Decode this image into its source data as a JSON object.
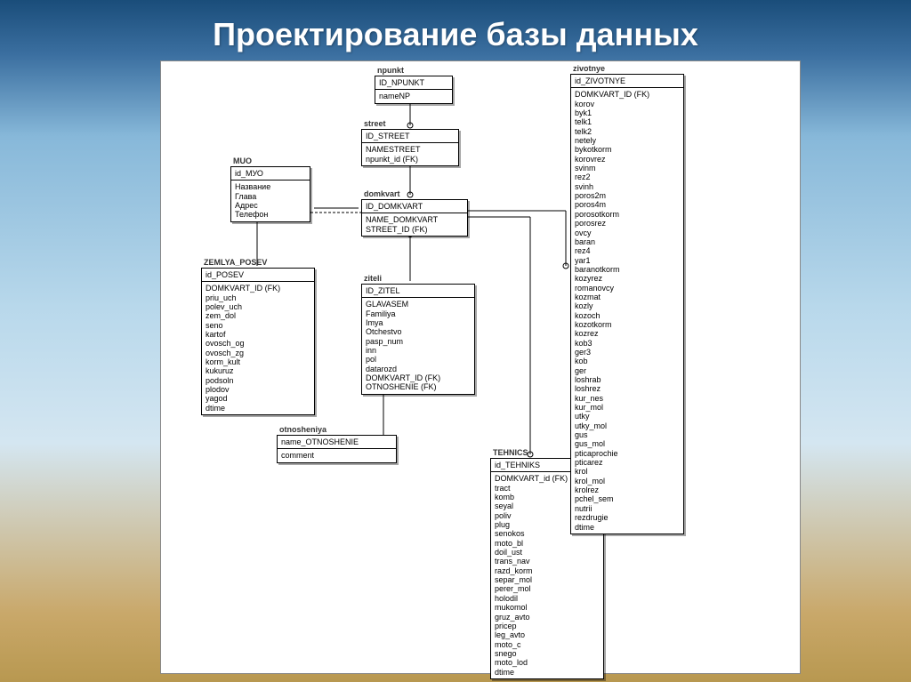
{
  "title": "Проектирование базы данных",
  "entities": {
    "npunkt": {
      "name": "npunkt",
      "pk": [
        "ID_NPUNKT"
      ],
      "fields": [
        "nameNP"
      ]
    },
    "street": {
      "name": "street",
      "pk": [
        "ID_STREET"
      ],
      "fields": [
        "NAMESTREET",
        "npunkt_id (FK)"
      ]
    },
    "muo": {
      "name": "MUO",
      "pk": [
        "id_МУО"
      ],
      "fields": [
        "Название",
        "Глава",
        "Адрес",
        "Телефон"
      ]
    },
    "domkvart": {
      "name": "domkvart",
      "pk": [
        "ID_DOMKVART"
      ],
      "fields": [
        "NAME_DOMKVART",
        "STREET_ID (FK)"
      ]
    },
    "zemlya": {
      "name": "ZEMLYA_POSEV",
      "pk": [
        "id_POSEV"
      ],
      "fields": [
        "DOMKVART_ID (FK)",
        "priu_uch",
        "polev_uch",
        "zem_dol",
        "seno",
        "kartof",
        "ovosch_og",
        "ovosch_zg",
        "korm_kult",
        "kukuruz",
        "podsoln",
        "plodov",
        "yagod",
        "dtime"
      ]
    },
    "ziteli": {
      "name": "ziteli",
      "pk": [
        "ID_ZITEL"
      ],
      "fields": [
        "GLAVASEM",
        "Familiya",
        "Imya",
        "Otchestvo",
        "pasp_num",
        "inn",
        "pol",
        "datarozd",
        "DOMKVART_ID (FK)",
        "OTNOSHENIE (FK)"
      ]
    },
    "otnosheniya": {
      "name": "otnosheniya",
      "pk": [
        "name_OTNOSHENIE"
      ],
      "fields": [
        "comment"
      ]
    },
    "zivotnye": {
      "name": "zivotnye",
      "pk": [
        "id_ZIVOTNYE"
      ],
      "fields": [
        "DOMKVART_ID (FK)",
        "korov",
        "byk1",
        "telk1",
        "telk2",
        "netely",
        "bykotkorm",
        "korovrez",
        "svinm",
        "rez2",
        "svinh",
        "poros2m",
        "poros4m",
        "porosotkorm",
        "porosrez",
        "ovcy",
        "baran",
        "rez4",
        "yar1",
        "baranotkorm",
        "kozyrez",
        "romanovcy",
        "kozmat",
        "kozly",
        "kozoch",
        "kozotkorm",
        "kozrez",
        "kob3",
        "ger3",
        "kob",
        "ger",
        "loshrab",
        "loshrez",
        "kur_nes",
        "kur_mol",
        "utky",
        "utky_mol",
        "gus",
        "gus_mol",
        "pticaprochie",
        "pticarez",
        "krol",
        "krol_mol",
        "krolrez",
        "pchel_sem",
        "nutrii",
        "rezdrugie",
        "dtime"
      ]
    },
    "tehnics": {
      "name": "TEHNICS",
      "pk": [
        "id_TEHNIKS"
      ],
      "fields": [
        "DOMKVART_id (FK)",
        "tract",
        "komb",
        "seyal",
        "poliv",
        "plug",
        "senokos",
        "moto_bl",
        "doil_ust",
        "trans_nav",
        "razd_korm",
        "separ_mol",
        "perer_mol",
        "holodil",
        "mukomol",
        "gruz_avto",
        "pricep",
        "leg_avto",
        "moto_c",
        "snego",
        "moto_lod",
        "dtime"
      ]
    }
  }
}
